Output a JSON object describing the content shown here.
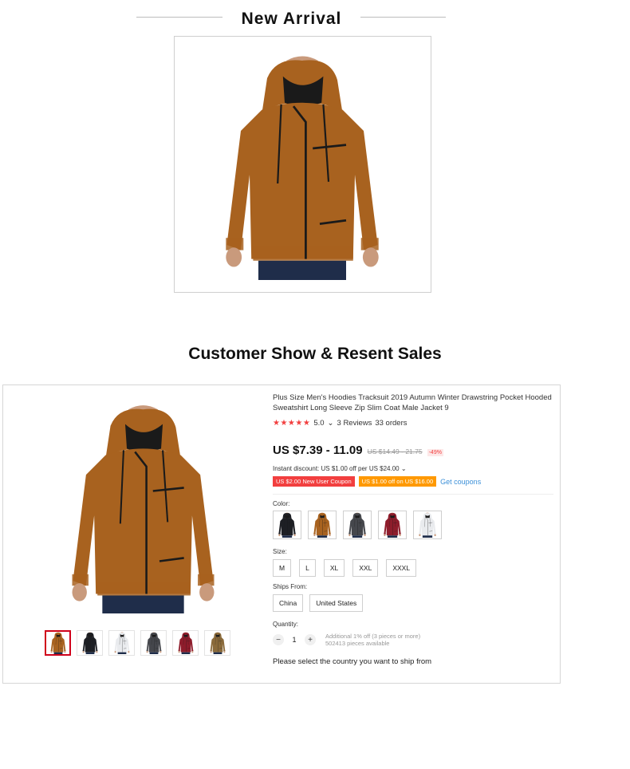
{
  "new_arrival": {
    "title": "New Arrival"
  },
  "customer_show": {
    "title": "Customer Show & Resent Sales"
  },
  "product": {
    "title": "Plus Size Men's Hoodies Tracksuit 2019 Autumn Winter Drawstring Pocket Hooded Sweatshirt Long Sleeve Zip Slim Coat Male Jacket 9",
    "stars": "★★★★★",
    "rating": "5.0",
    "reviews": "3 Reviews",
    "orders": "33 orders",
    "price": "US $7.39 - 11.09",
    "old_price": "US $14.49 - 21.75",
    "discount": "-49%",
    "instant_discount": "Instant discount: US $1.00 off per US $24.00",
    "coupon_1": "US $2.00 New User Coupon",
    "coupon_2": "US $1.00 off on US $16.00",
    "get_coupons": "Get coupons",
    "color_label": "Color:",
    "colors": [
      "black-hoodie-icon",
      "brown-hoodie-icon",
      "dark-gray-hoodie-icon",
      "burgundy-hoodie-icon",
      "white-hoodie-icon"
    ],
    "size_label": "Size:",
    "sizes": [
      "M",
      "L",
      "XL",
      "XXL",
      "XXXL"
    ],
    "ships_from_label": "Ships From:",
    "ships_from": [
      "China",
      "United States"
    ],
    "quantity_label": "Quantity:",
    "quantity": "1",
    "qty_minus": "−",
    "qty_plus": "+",
    "additional_discount": "Additional 1% off (3 pieces or more)",
    "pieces_available": "502413 pieces available",
    "select_country": "Please select the country you want to ship from"
  },
  "colors_hex": {
    "brown": "#a8621f",
    "black": "#1d1f24",
    "dark_gray": "#45474c",
    "burgundy": "#8e1c2b",
    "white": "#e9ebee",
    "price_red": "#f23f3f",
    "coupon_orange": "#ff9900",
    "link_blue": "#3a8fd8"
  }
}
